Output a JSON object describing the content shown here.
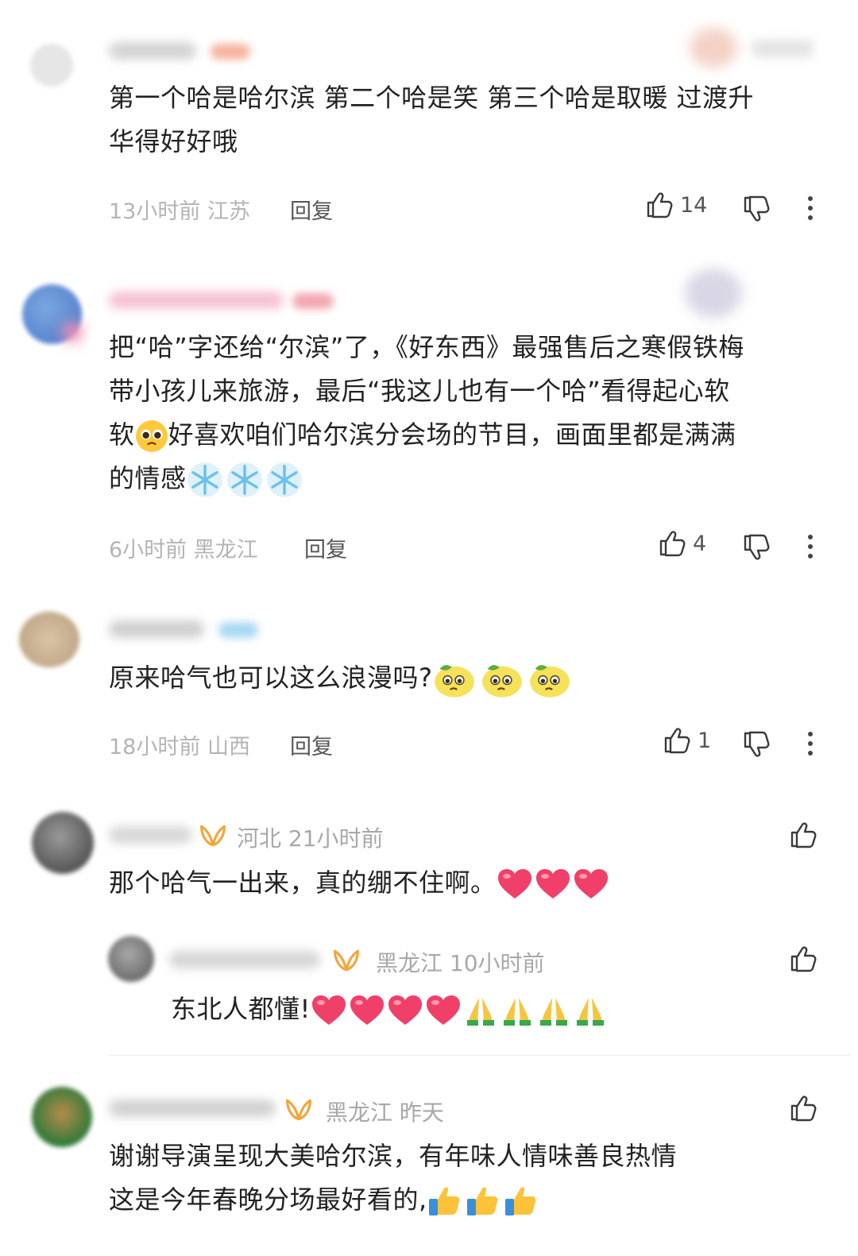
{
  "comments": [
    {
      "text_line1": "第一个哈是哈尔滨 第二个哈是笑 第三个哈是取暖 过渡升",
      "text_line2": "华得好好哦",
      "time": "13小时前",
      "region": "江苏",
      "reply_label": "回复",
      "likes": "14"
    },
    {
      "text_line1": "把“哈”字还给“尔滨”了，《好东西》最强售后之寒假铁梅",
      "text_line2": "带小孩儿来旅游，最后“我这儿也有一个哈”看得起心软",
      "text_line3a": "软",
      "text_line3b": "好喜欢咱们哈尔滨分会场的节目，画面里都是满满",
      "text_line4": "的情感",
      "time": "6小时前",
      "region": "黑龙江",
      "reply_label": "回复",
      "likes": "4"
    },
    {
      "text_line1": "原来哈气也可以这么浪漫吗?",
      "time": "18小时前",
      "region": "山西",
      "reply_label": "回复",
      "likes": "1"
    },
    {
      "meta": "河北 21小时前",
      "text_line1": "那个哈气一出来，真的绷不住啊。"
    },
    {
      "meta": "黑龙江 10小时前",
      "text_line1": "东北人都懂!"
    },
    {
      "meta": "黑龙江 昨天",
      "text_line1": "谢谢导演呈现大美哈尔滨，有年味人情味善良热情",
      "text_line2": "这是今年春晚分场最好看的,"
    }
  ],
  "icons": {
    "like": "thumbs-up-icon",
    "dislike": "thumbs-down-icon",
    "more": "more-vertical-icon",
    "vip": "vip-badge-icon"
  },
  "colors": {
    "meta": "#b4b4b4",
    "vip": "#f0a040",
    "heart": "#f0406a"
  }
}
